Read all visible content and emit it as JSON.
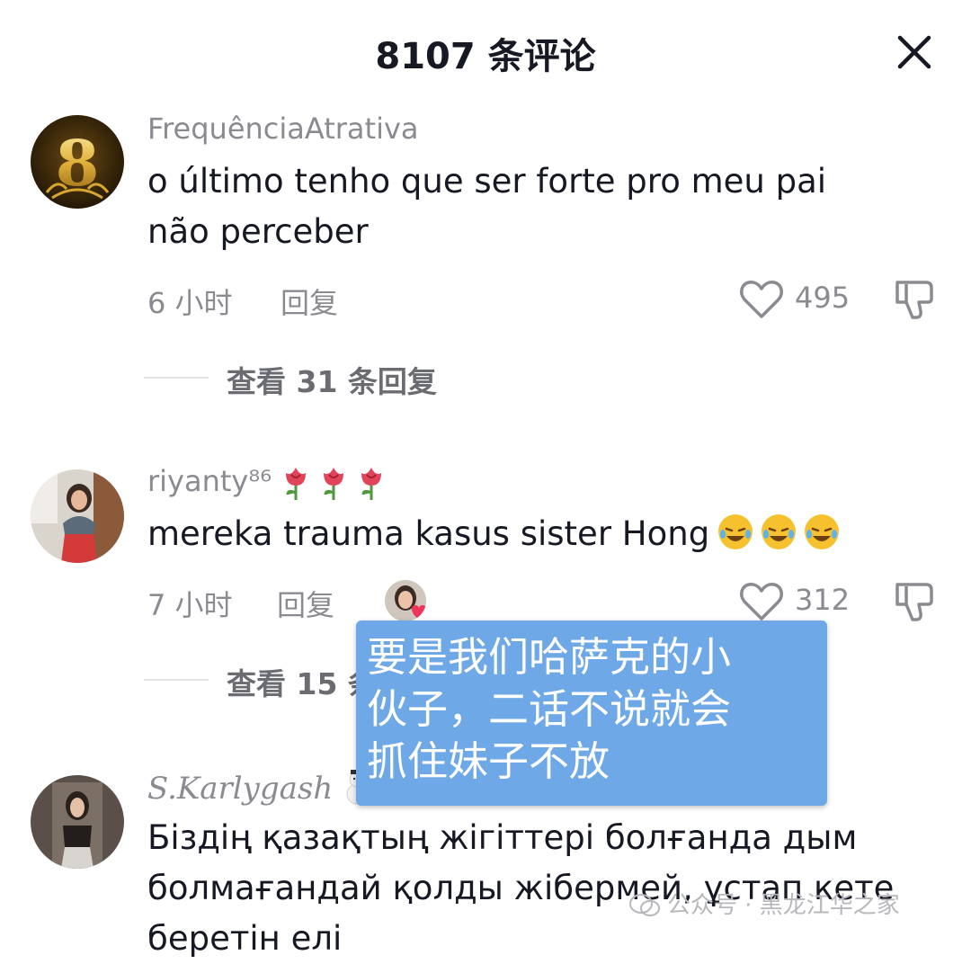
{
  "header": {
    "title": "8107 条评论"
  },
  "comments": [
    {
      "username": "FrequênciaAtrativa",
      "text": "o último tenho que ser forte pro meu pai não perceber",
      "time": "6 小时",
      "reply_label": "回复",
      "likes": "495",
      "view_replies": "查看 31 条回复"
    },
    {
      "username": "riyanty⁸⁶",
      "text": "mereka trauma kasus sister Hong",
      "time": "7 小时",
      "reply_label": "回复",
      "likes": "312",
      "view_replies": "查看 15 条回复"
    },
    {
      "username": "S.Karlygash",
      "text": "Біздің қазақтың жігіттері болғанда дым болмағандай қолды жібермей, ұстап кете беретін елі"
    }
  ],
  "overlay": {
    "lines": [
      "要是我们哈萨克的小",
      "伙子，二话不说就会",
      "抓住妹子不放"
    ]
  },
  "watermark": {
    "text": "公众号 · 黑龙江华之家"
  },
  "colors": {
    "overlay_bg": "#6fa8e6",
    "secondary_text": "#8a8b91",
    "primary_text": "#161823"
  }
}
